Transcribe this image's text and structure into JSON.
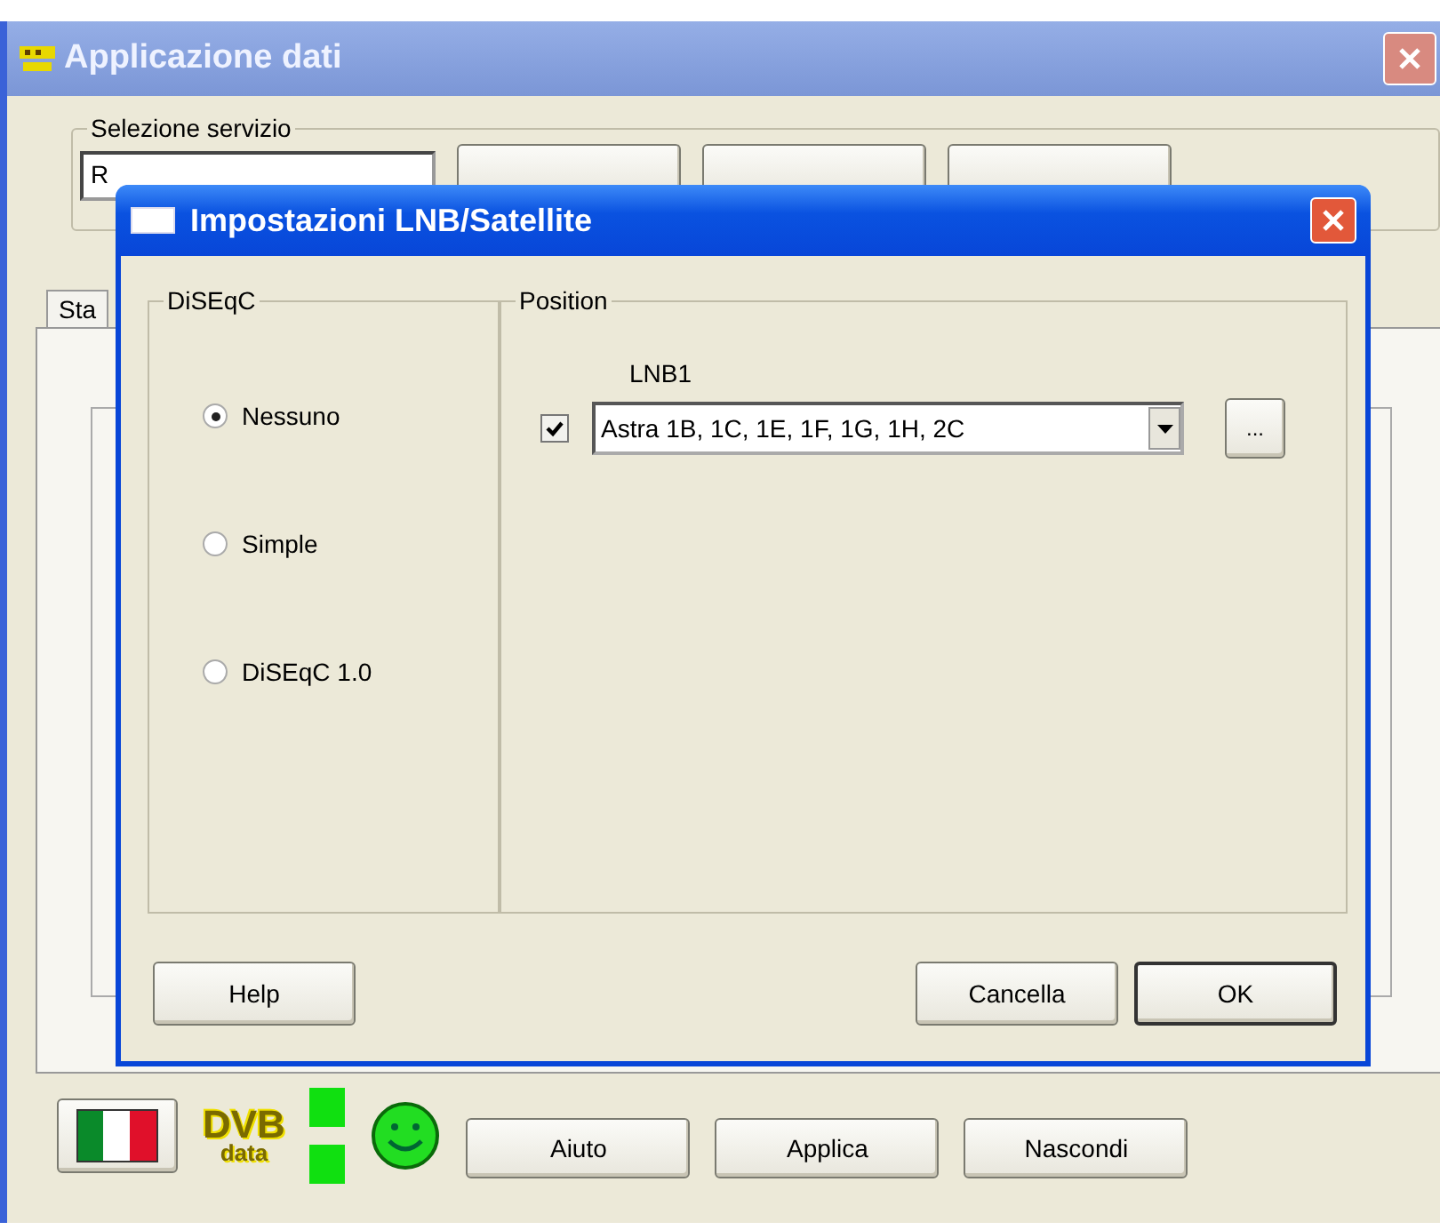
{
  "main_window": {
    "title": "Applicazione dati",
    "service_group": {
      "label": "Selezione servizio",
      "combo_value": "R"
    },
    "tab": {
      "label": "Sta"
    },
    "logo_text": [
      "DVB",
      "data"
    ],
    "bottom_buttons": [
      "Aiuto",
      "Applica",
      "Nascondi"
    ]
  },
  "dialog": {
    "title": "Impostazioni LNB/Satellite",
    "diseqc": {
      "label": "DiSEqC",
      "options": [
        {
          "label": "Nessuno",
          "selected": true
        },
        {
          "label": "Simple",
          "selected": false
        },
        {
          "label": "DiSEqC 1.0",
          "selected": false
        }
      ]
    },
    "position": {
      "label": "Position",
      "lnbs": [
        {
          "label": "LNB1",
          "checked": true,
          "value": "Astra 1B, 1C, 1E, 1F, 1G, 1H, 2C",
          "browse": "..."
        }
      ]
    },
    "buttons": [
      {
        "label": "Help",
        "kind": "plain"
      },
      {
        "label": "Cancella",
        "kind": "plain"
      },
      {
        "label": "OK",
        "kind": "default"
      }
    ]
  }
}
